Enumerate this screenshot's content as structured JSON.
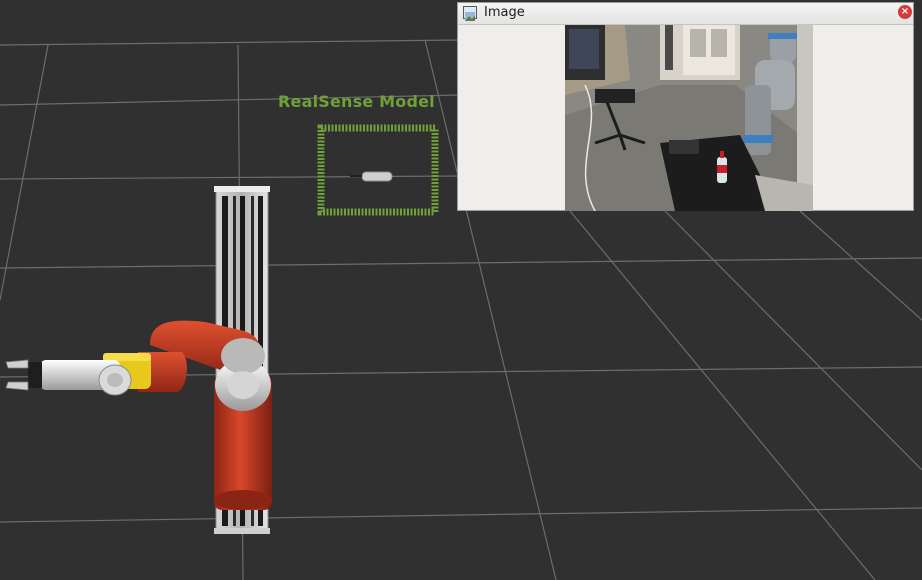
{
  "scene": {
    "model_label": "RealSense Model",
    "colors": {
      "background": "#303030",
      "grid": "#6a6a6a",
      "model_marker": "#6fa13a",
      "robot_red": "#c63a22",
      "gripper_yellow": "#e8c81a"
    }
  },
  "image_window": {
    "title": "Image",
    "icons": {
      "window": "image-icon",
      "close": "close-icon"
    }
  }
}
